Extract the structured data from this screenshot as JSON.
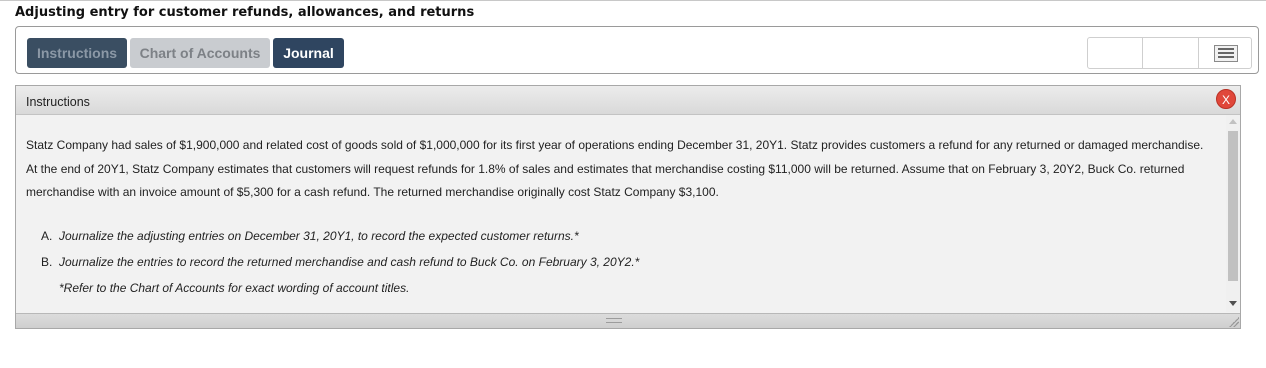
{
  "page": {
    "title": "Adjusting entry for customer refunds, allowances, and returns"
  },
  "tabs": [
    {
      "label": "Instructions",
      "state": "inactive"
    },
    {
      "label": "Chart of Accounts",
      "state": "inactive"
    },
    {
      "label": "Journal",
      "state": "active"
    }
  ],
  "toolbar_icons": {
    "menu": "menu-icon"
  },
  "instructions_panel": {
    "title": "Instructions",
    "close_label": "X",
    "paragraph": "Statz Company had sales of $1,900,000 and related cost of goods sold of $1,000,000 for its first year of operations ending December 31, 20Y1. Statz provides customers a refund for any returned or damaged merchandise. At the end of 20Y1, Statz Company estimates that customers will request refunds for 1.8% of sales and estimates that merchandise costing $11,000 will be returned. Assume that on February 3, 20Y2, Buck Co. returned merchandise with an invoice amount of $5,300 for a cash refund. The returned merchandise originally cost Statz Company $3,100.",
    "tasks": [
      {
        "letter": "A.",
        "text": "Journalize the adjusting entries on December 31, 20Y1, to record the expected customer returns.*"
      },
      {
        "letter": "B.",
        "text": "Journalize the entries to record the returned merchandise and cash refund to Buck Co. on February 3, 20Y2.*"
      }
    ],
    "note": "*Refer to the Chart of Accounts for exact wording of account titles."
  },
  "colors": {
    "active_tab": "#2f4560",
    "inactive_tab_dark": "#3a4e62",
    "inactive_tab_light": "#c9ccd0",
    "close_button": "#e0473a"
  }
}
